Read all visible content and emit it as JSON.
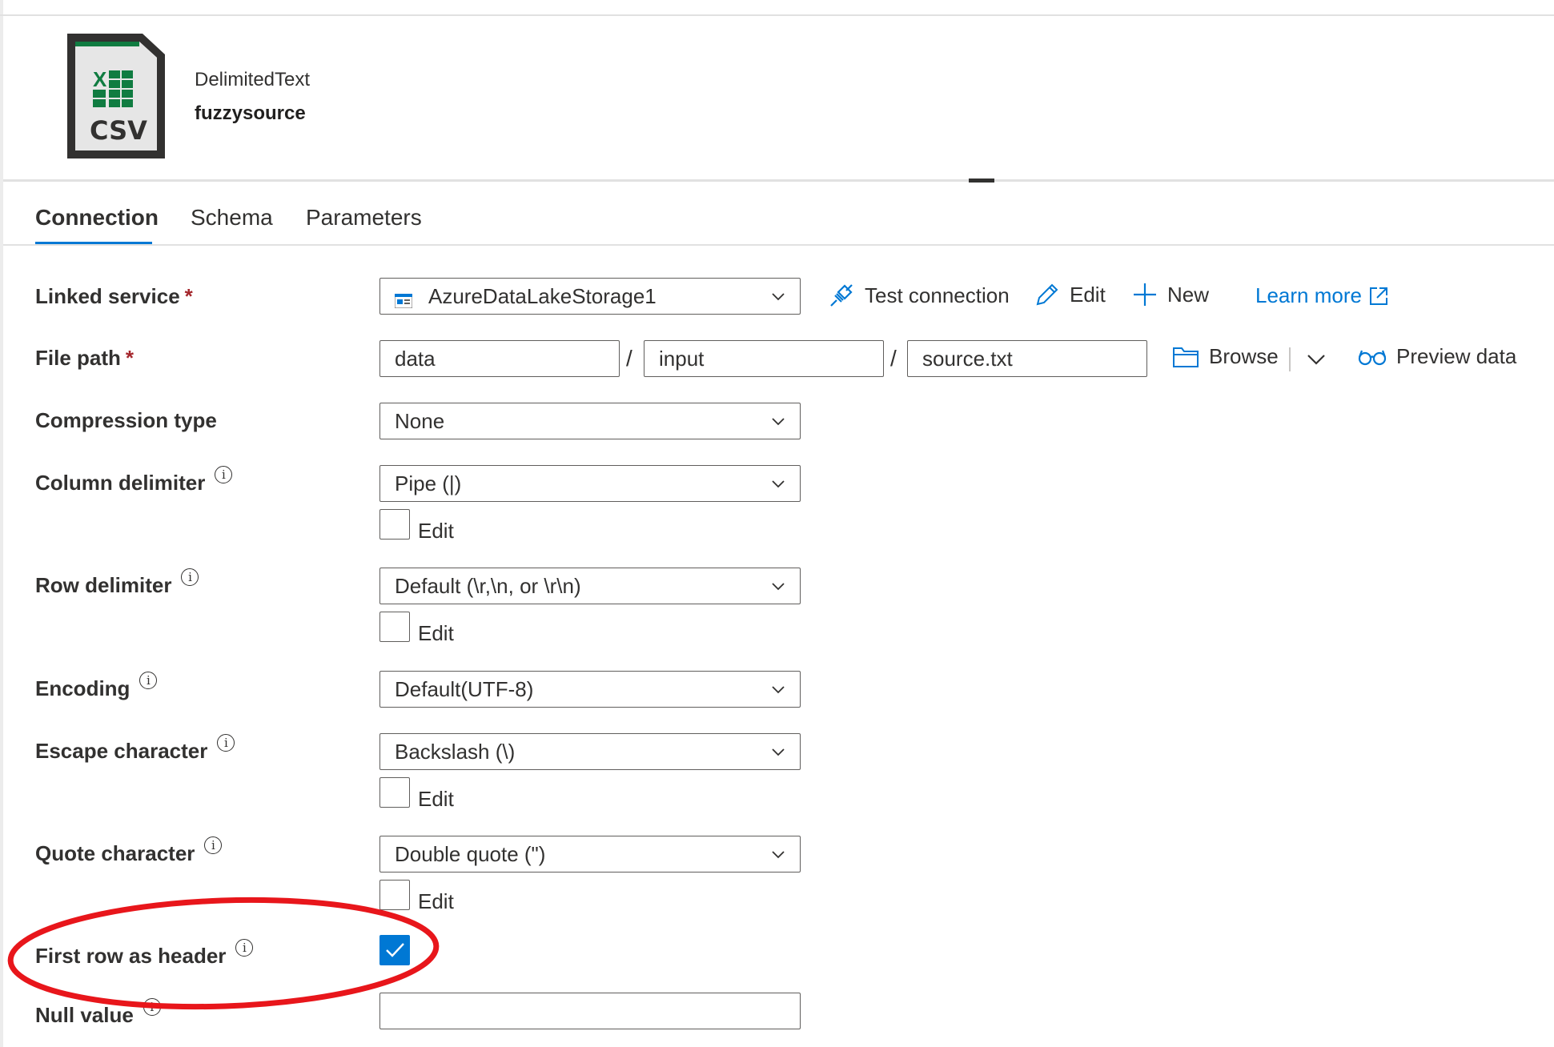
{
  "dataset": {
    "type": "DelimitedText",
    "name": "fuzzysource",
    "icon": "csv-file-icon",
    "icon_text": "CSV"
  },
  "tabs": [
    {
      "label": "Connection",
      "active": true
    },
    {
      "label": "Schema",
      "active": false
    },
    {
      "label": "Parameters",
      "active": false
    }
  ],
  "linked_service": {
    "label": "Linked service",
    "required_mark": "*",
    "value": "AzureDataLakeStorage1",
    "actions": {
      "test_connection": "Test connection",
      "edit": "Edit",
      "new": "New",
      "learn_more": "Learn more"
    }
  },
  "file_path": {
    "label": "File path",
    "required_mark": "*",
    "container": "data",
    "directory": "input",
    "file": "source.txt",
    "separator": "/",
    "browse": "Browse",
    "preview": "Preview data"
  },
  "compression_type": {
    "label": "Compression type",
    "value": "None"
  },
  "column_delimiter": {
    "label": "Column delimiter",
    "value": "Pipe (|)",
    "edit_label": "Edit",
    "edit_checked": false
  },
  "row_delimiter": {
    "label": "Row delimiter",
    "value": "Default (\\r,\\n, or \\r\\n)",
    "edit_label": "Edit",
    "edit_checked": false
  },
  "encoding": {
    "label": "Encoding",
    "value": "Default(UTF-8)"
  },
  "escape_character": {
    "label": "Escape character",
    "value": "Backslash (\\)",
    "edit_label": "Edit",
    "edit_checked": false
  },
  "quote_character": {
    "label": "Quote character",
    "value": "Double quote (\")",
    "edit_label": "Edit",
    "edit_checked": false
  },
  "first_row_as_header": {
    "label": "First row as header",
    "checked": true
  },
  "null_value": {
    "label": "Null value",
    "value": ""
  },
  "info_glyph": "i",
  "colors": {
    "accent": "#0078d4",
    "highlight": "#e8161b",
    "excel_green": "#107c41"
  }
}
